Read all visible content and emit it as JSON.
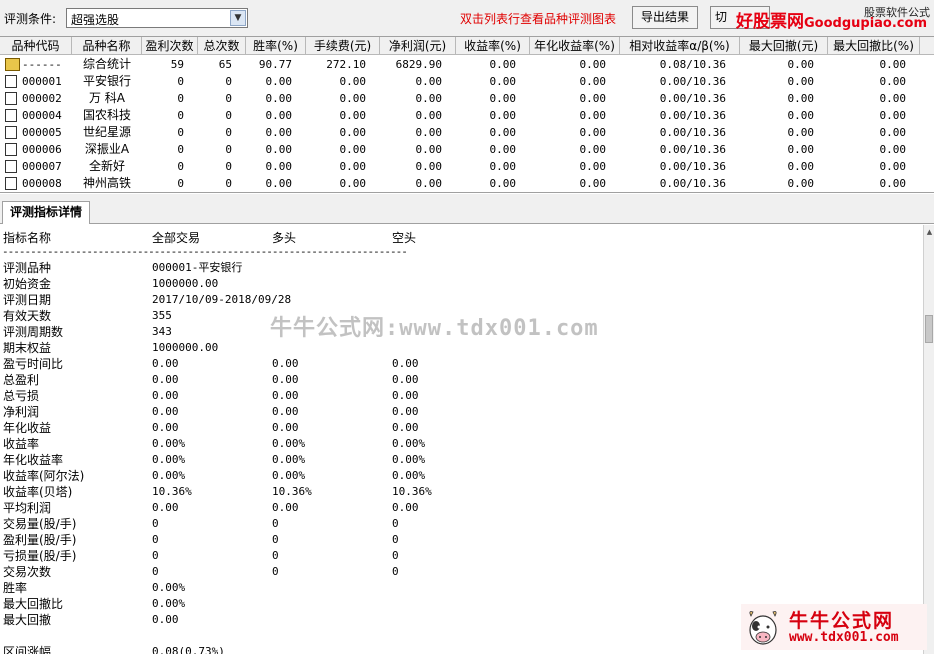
{
  "toolbar": {
    "condition_label": "评测条件:",
    "condition_value": "超强选股",
    "hint": "双击列表行查看品种评测图表",
    "export_label": "导出结果",
    "switch_label": "切",
    "logo_cn": "好股票网",
    "logo_en": "Goodgupiao.com",
    "logo_small": "股票软件公式"
  },
  "table": {
    "columns": [
      "品种代码",
      "品种名称",
      "盈利次数",
      "总次数",
      "胜率(%)",
      "手续费(元)",
      "净利润(元)",
      "收益率(%)",
      "年化收益率(%)",
      "相对收益率α/β(%)",
      "最大回撤(元)",
      "最大回撤比(%)"
    ],
    "rows": [
      [
        "------",
        "综合统计",
        "59",
        "65",
        "90.77",
        "272.10",
        "6829.90",
        "0.00",
        "0.00",
        "0.08/10.36",
        "0.00",
        "0.00"
      ],
      [
        "000001",
        "平安银行",
        "0",
        "0",
        "0.00",
        "0.00",
        "0.00",
        "0.00",
        "0.00",
        "0.00/10.36",
        "0.00",
        "0.00"
      ],
      [
        "000002",
        "万 科A",
        "0",
        "0",
        "0.00",
        "0.00",
        "0.00",
        "0.00",
        "0.00",
        "0.00/10.36",
        "0.00",
        "0.00"
      ],
      [
        "000004",
        "国农科技",
        "0",
        "0",
        "0.00",
        "0.00",
        "0.00",
        "0.00",
        "0.00",
        "0.00/10.36",
        "0.00",
        "0.00"
      ],
      [
        "000005",
        "世纪星源",
        "0",
        "0",
        "0.00",
        "0.00",
        "0.00",
        "0.00",
        "0.00",
        "0.00/10.36",
        "0.00",
        "0.00"
      ],
      [
        "000006",
        "深振业A",
        "0",
        "0",
        "0.00",
        "0.00",
        "0.00",
        "0.00",
        "0.00",
        "0.00/10.36",
        "0.00",
        "0.00"
      ],
      [
        "000007",
        "全新好",
        "0",
        "0",
        "0.00",
        "0.00",
        "0.00",
        "0.00",
        "0.00",
        "0.00/10.36",
        "0.00",
        "0.00"
      ],
      [
        "000008",
        "神州高铁",
        "0",
        "0",
        "0.00",
        "0.00",
        "0.00",
        "0.00",
        "0.00",
        "0.00/10.36",
        "0.00",
        "0.00"
      ]
    ]
  },
  "tab": {
    "label": "评测指标详情"
  },
  "details": {
    "headers": [
      "指标名称",
      "全部交易",
      "多头",
      "空头"
    ],
    "divider": "------------------------------------------------------------------------",
    "rows": [
      [
        "评测品种",
        "000001-平安银行",
        "",
        ""
      ],
      [
        "初始资金",
        "1000000.00",
        "",
        ""
      ],
      [
        "评测日期",
        "2017/10/09-2018/09/28",
        "",
        ""
      ],
      [
        "有效天数",
        "355",
        "",
        ""
      ],
      [
        "评测周期数",
        "343",
        "",
        ""
      ],
      [
        "期末权益",
        "1000000.00",
        "",
        ""
      ],
      [
        "盈亏时间比",
        "0.00",
        "0.00",
        "0.00"
      ],
      [
        "总盈利",
        "0.00",
        "0.00",
        "0.00"
      ],
      [
        "总亏损",
        "0.00",
        "0.00",
        "0.00"
      ],
      [
        "净利润",
        "0.00",
        "0.00",
        "0.00"
      ],
      [
        "年化收益",
        "0.00",
        "0.00",
        "0.00"
      ],
      [
        "收益率",
        "0.00%",
        "0.00%",
        "0.00%"
      ],
      [
        "年化收益率",
        "0.00%",
        "0.00%",
        "0.00%"
      ],
      [
        "收益率(阿尔法)",
        "0.00%",
        "0.00%",
        "0.00%"
      ],
      [
        "收益率(贝塔)",
        "10.36%",
        "10.36%",
        "10.36%"
      ],
      [
        "平均利润",
        "0.00",
        "0.00",
        "0.00"
      ],
      [
        "交易量(股/手)",
        "0",
        "0",
        "0"
      ],
      [
        "盈利量(股/手)",
        "0",
        "0",
        "0"
      ],
      [
        "亏损量(股/手)",
        "0",
        "0",
        "0"
      ],
      [
        "交易次数",
        "0",
        "0",
        "0"
      ],
      [
        "胜率",
        "0.00%",
        "",
        ""
      ],
      [
        "最大回撤比",
        "0.00%",
        "",
        ""
      ],
      [
        "最大回撤",
        "0.00",
        "",
        ""
      ],
      [
        "",
        "",
        "",
        ""
      ],
      [
        "区间涨幅",
        "0.08(0.73%)",
        "",
        ""
      ]
    ]
  },
  "watermark": "牛牛公式网:www.tdx001.com",
  "bottom_logo": {
    "title": "牛牛公式网",
    "url": "www.tdx001.com"
  }
}
